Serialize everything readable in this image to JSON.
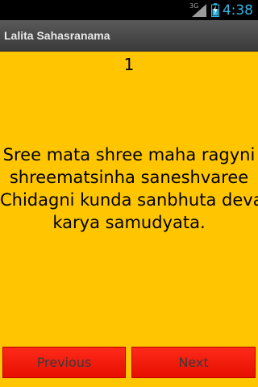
{
  "status_bar": {
    "time": "4:38",
    "network_label": "3G",
    "signal_icon": "signal-icon",
    "battery_icon": "battery-charging-icon"
  },
  "app": {
    "title": "Lalita Sahasranama"
  },
  "main": {
    "counter": "1",
    "verse_lines": [
      "Sree mata shree maha ragyni",
      "shreematsinha saneshvaree",
      "Chidagni kunda sanbhuta deva",
      "karya samudyata."
    ]
  },
  "buttons": {
    "previous": "Previous",
    "next": "Next"
  },
  "colors": {
    "background": "#ffc600",
    "button": "#f51a0a",
    "title_bar": "#4a4a4a",
    "status_accent": "#33b5e5"
  }
}
